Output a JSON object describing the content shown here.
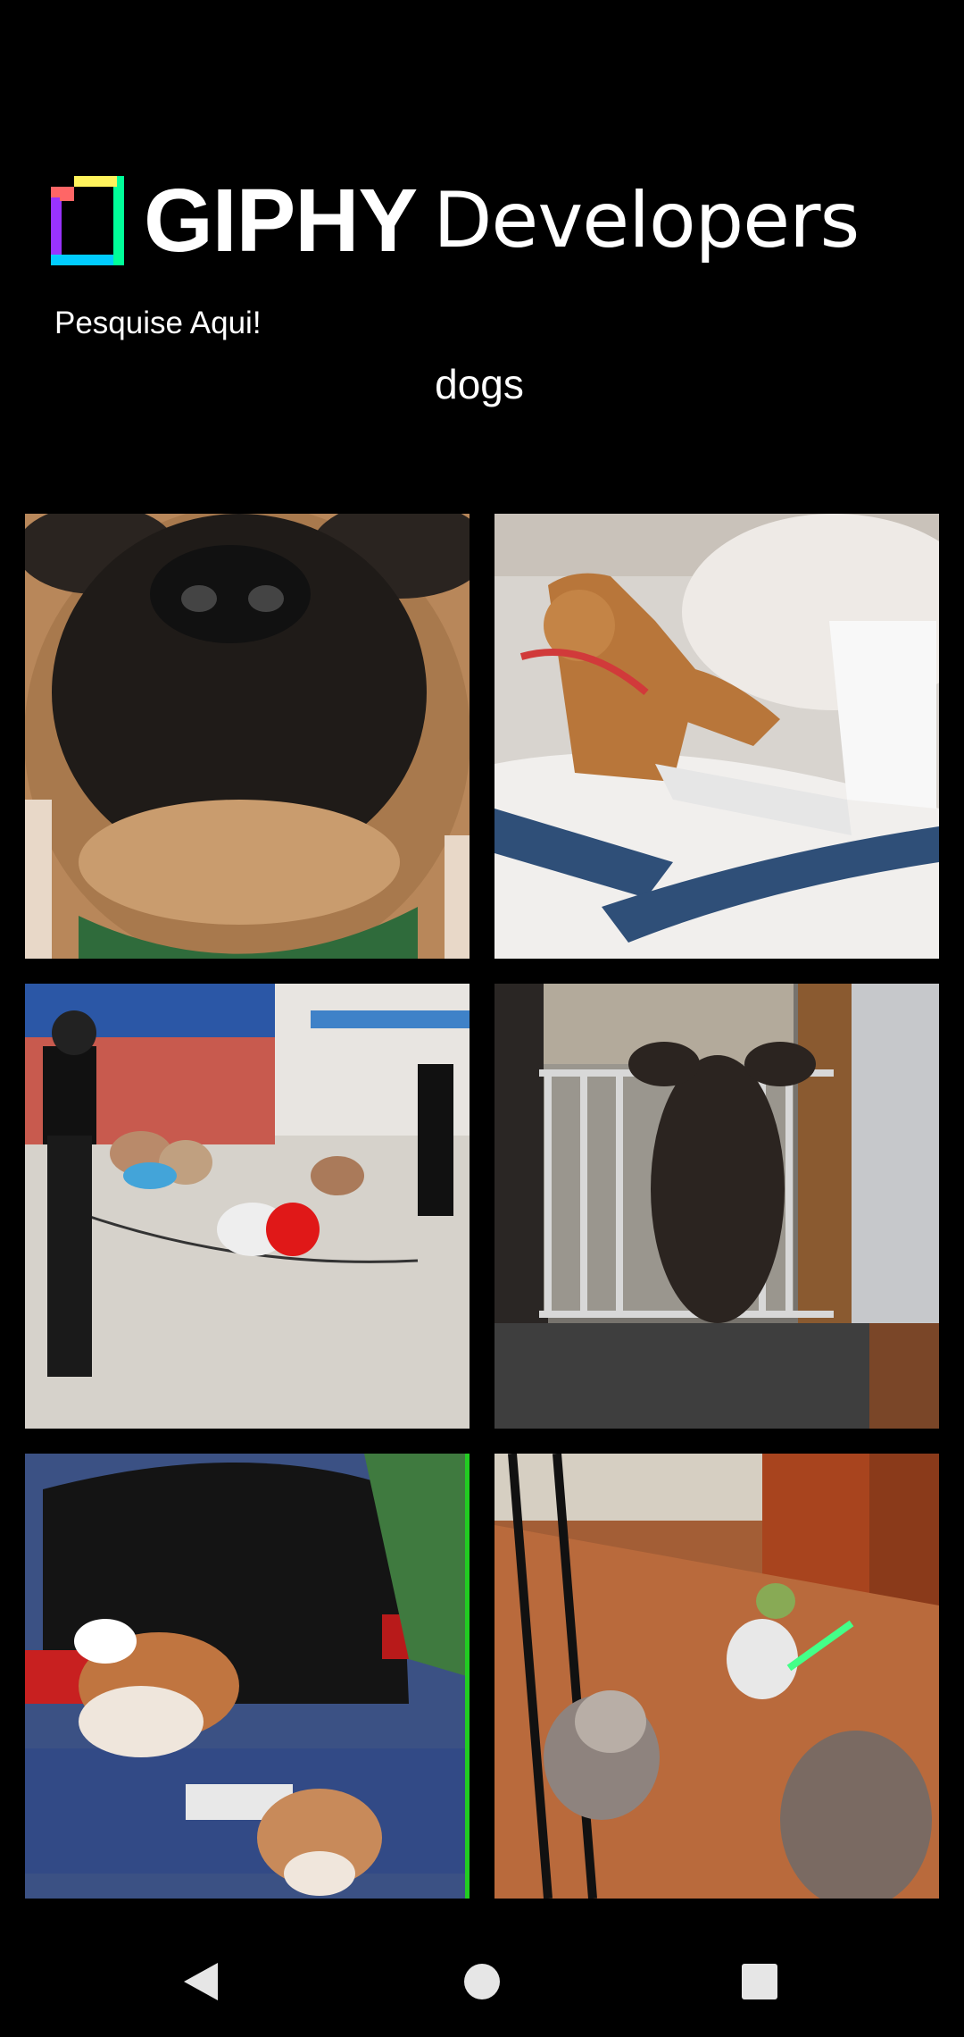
{
  "header": {
    "logo_primary": "GIPHY",
    "logo_secondary": "Developers"
  },
  "search": {
    "label": "Pesquise Aqui!",
    "value": "dogs"
  },
  "results": [
    {
      "subject": "pug face close-up"
    },
    {
      "subject": "shiba inu typing on laptop"
    },
    {
      "subject": "poodles jumping rope"
    },
    {
      "subject": "dog standing at gate"
    },
    {
      "subject": "beagles jumping from car trunk"
    },
    {
      "subject": "dogs chasing toy in hallway"
    }
  ],
  "navbar": {
    "back_icon": "back-triangle-icon",
    "home_icon": "home-circle-icon",
    "recents_icon": "recents-square-icon"
  },
  "colors": {
    "background": "#000000",
    "text": "#ffffff",
    "nav_icon": "#e6e6e6"
  }
}
